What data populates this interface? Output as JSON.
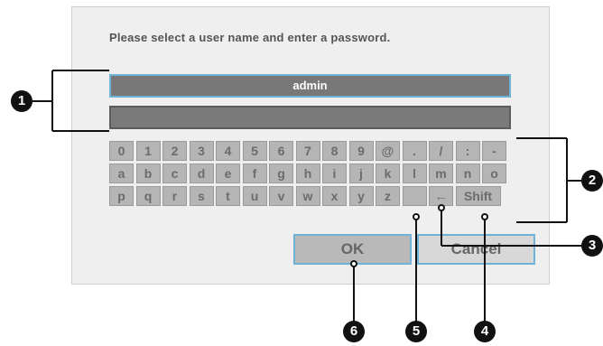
{
  "prompt": "Please select a user name and enter a password.",
  "username_value": "admin",
  "password_value": "",
  "keyboard_rows": [
    [
      "0",
      "1",
      "2",
      "3",
      "4",
      "5",
      "6",
      "7",
      "8",
      "9",
      "@",
      ".",
      "/",
      ":",
      "-"
    ],
    [
      "a",
      "b",
      "c",
      "d",
      "e",
      "f",
      "g",
      "h",
      "i",
      "j",
      "k",
      "l",
      "m",
      "n",
      "o"
    ],
    [
      "p",
      "q",
      "r",
      "s",
      "t",
      "u",
      "v",
      "w",
      "x",
      "y",
      "z",
      "",
      "←",
      "Shift"
    ]
  ],
  "buttons": {
    "ok": "OK",
    "cancel": "Cancel"
  },
  "callouts": [
    "1",
    "2",
    "3",
    "4",
    "5",
    "6"
  ],
  "colors": {
    "accent": "#6cb3d6",
    "field": "#787878",
    "key": "#b5b5b5"
  }
}
